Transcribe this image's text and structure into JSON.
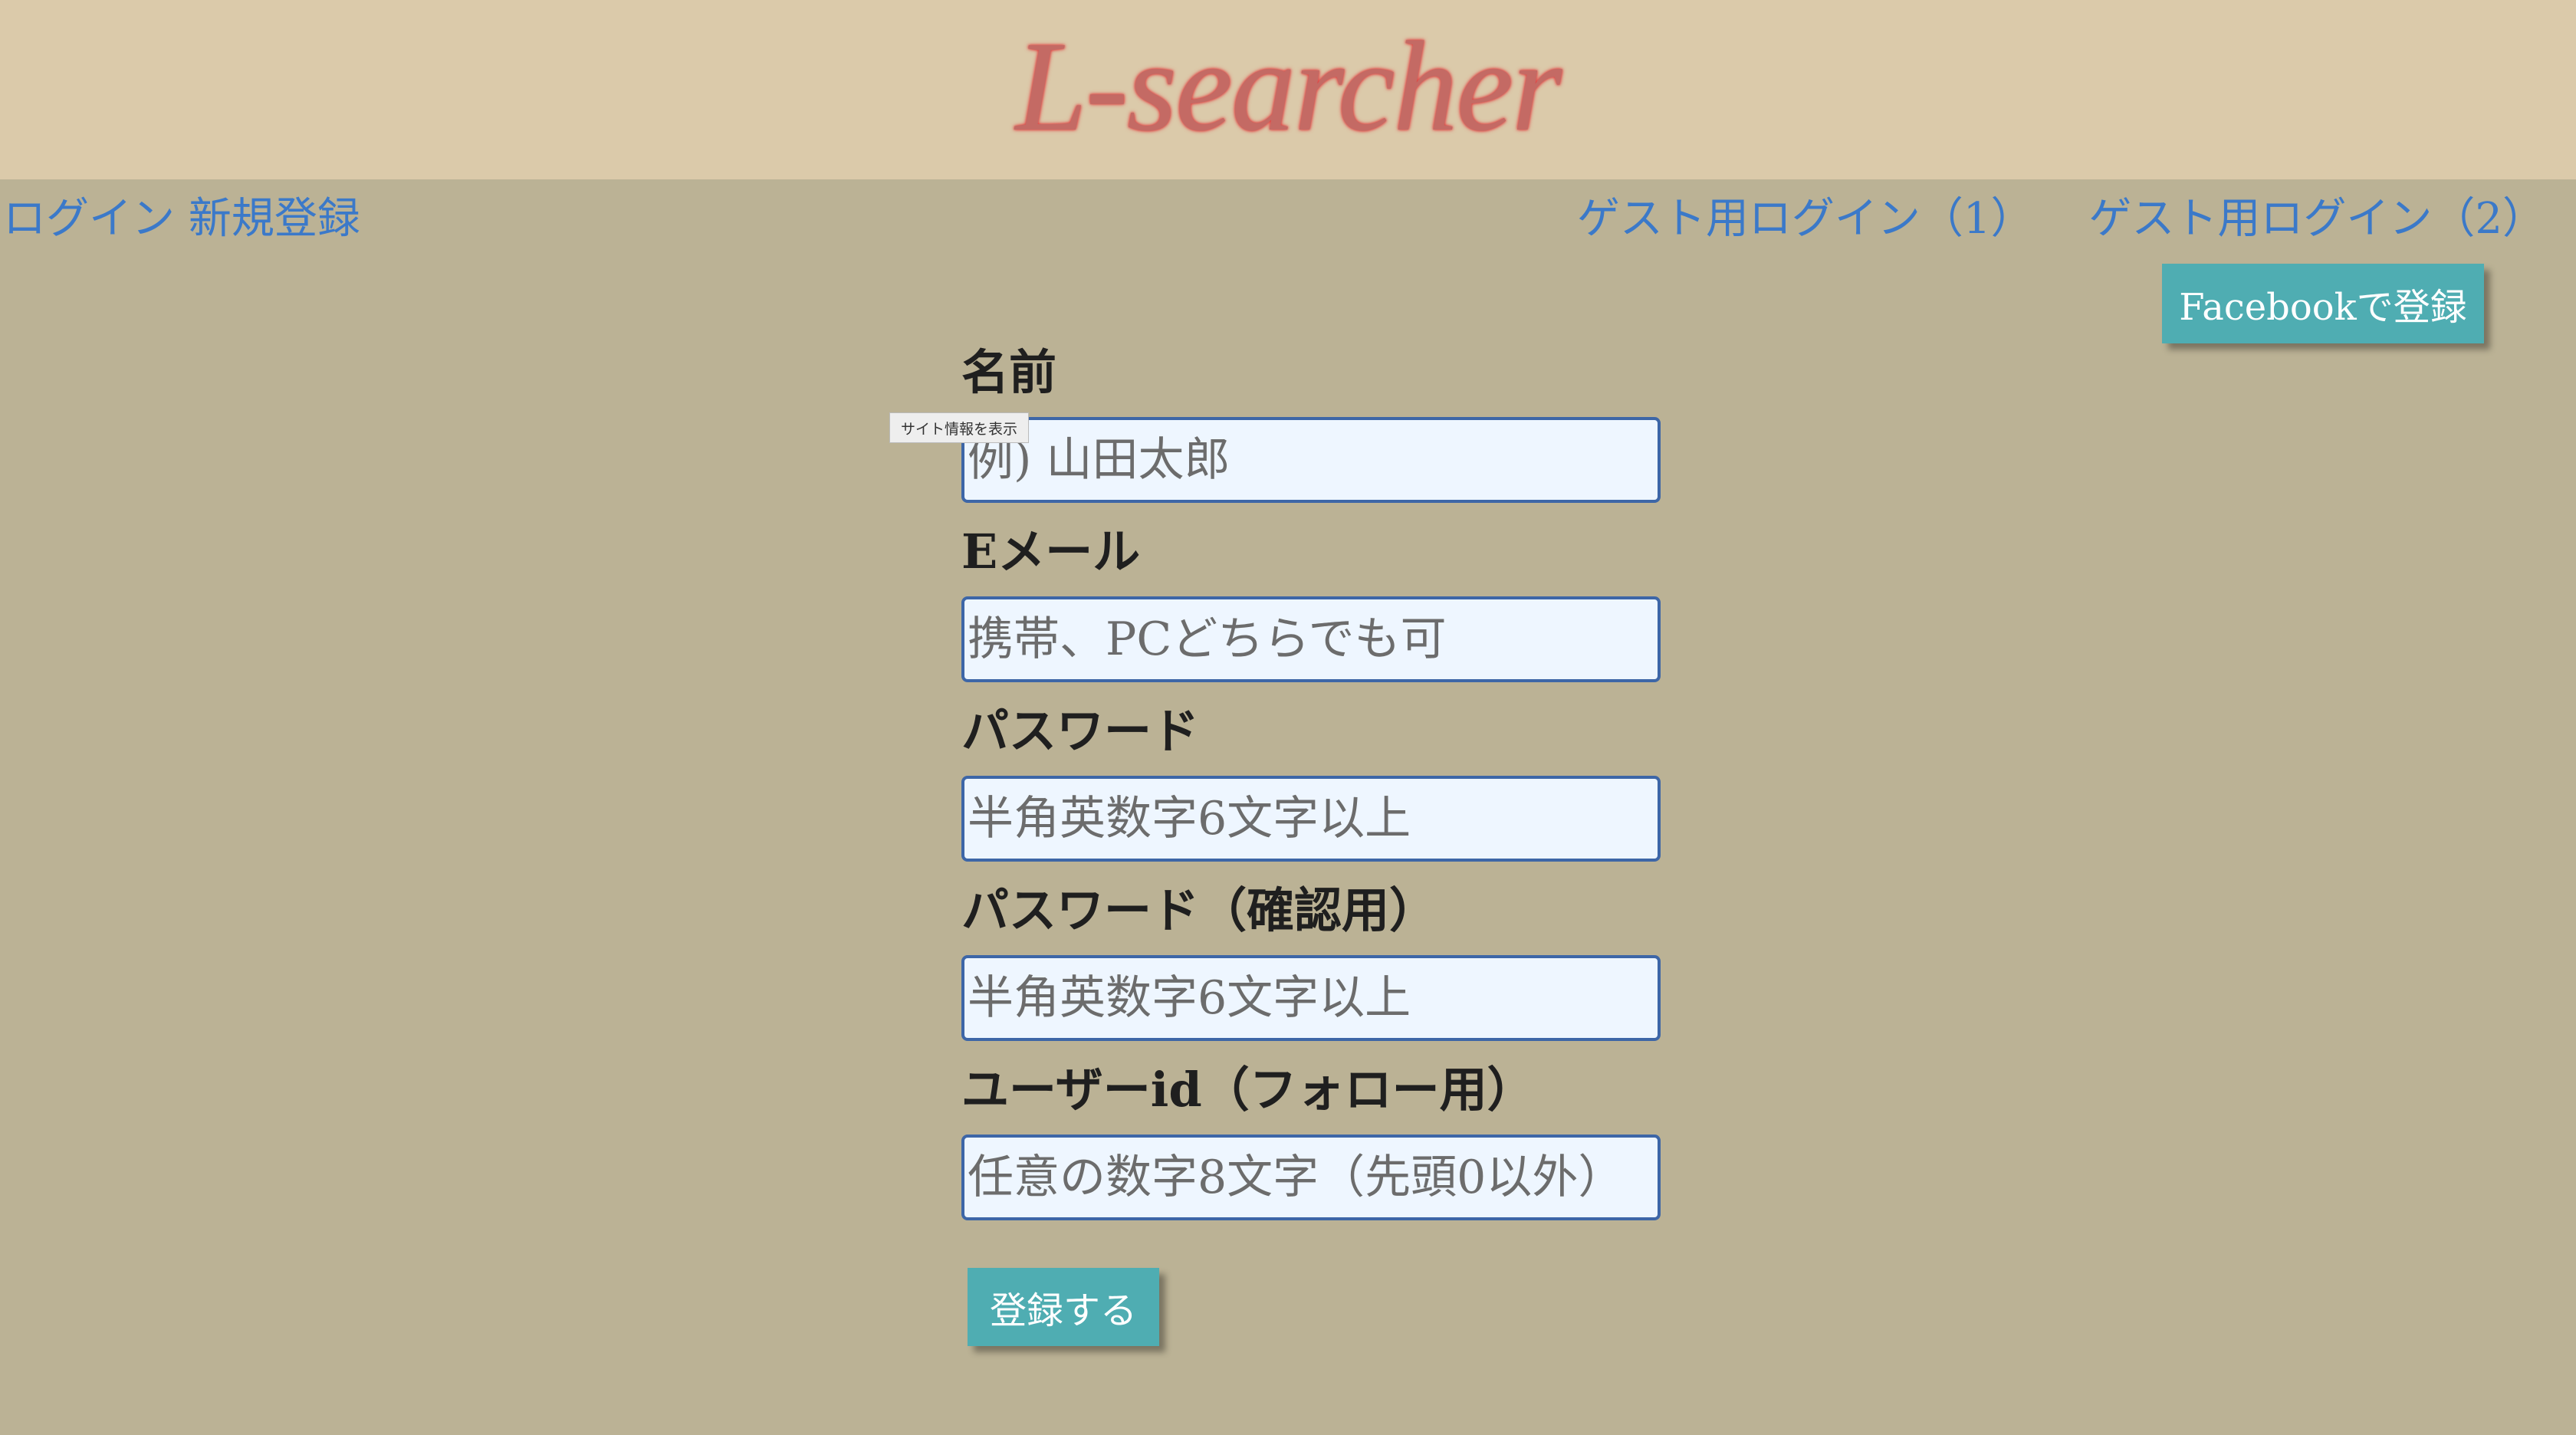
{
  "header": {
    "logo": "L-searcher"
  },
  "nav": {
    "login": "ログイン",
    "signup": "新規登録",
    "guest_login_1": "ゲスト用ログイン（1）",
    "guest_login_2": "ゲスト用ログイン（2）"
  },
  "facebook_button": "Facebookで登録",
  "tooltip": "サイト情報を表示",
  "form": {
    "fields": [
      {
        "label": "名前",
        "placeholder": "例) 山田太郎"
      },
      {
        "label": "Eメール",
        "placeholder": "携帯、PCどちらでも可"
      },
      {
        "label": "パスワード",
        "placeholder": "半角英数字6文字以上"
      },
      {
        "label": "パスワード（確認用）",
        "placeholder": "半角英数字6文字以上"
      },
      {
        "label": "ユーザーid（フォロー用）",
        "placeholder": "任意の数字8文字（先頭0以外）"
      }
    ],
    "submit": "登録する"
  },
  "colors": {
    "page_background": "#bbb295",
    "header_background": "#dbcaaa",
    "link": "#3b79c9",
    "button": "#4fadb2",
    "logo": "#c46a64"
  }
}
